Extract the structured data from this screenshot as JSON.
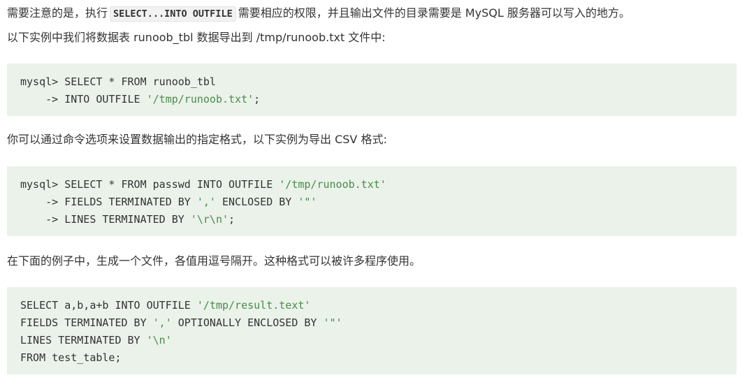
{
  "paragraphs": {
    "p1": {
      "before": "需要注意的是，执行",
      "code": "SELECT...INTO OUTFILE",
      "after": "需要相应的权限，并且输出文件的目录需要是 MySQL 服务器可以写入的地方。"
    },
    "p2": "以下实例中我们将数据表 runoob_tbl 数据导出到 /tmp/runoob.txt 文件中:",
    "p3": "你可以通过命令选项来设置数据输出的指定格式，以下实例为导出 CSV 格式:",
    "p4": "在下面的例子中，生成一个文件，各值用逗号隔开。这种格式可以被许多程序使用。"
  },
  "code_blocks": [
    {
      "lines": [
        {
          "a": "mysql> SELECT * FROM runoob_tbl",
          "s": "",
          "b": ""
        },
        {
          "a": "    -> INTO OUTFILE ",
          "s": "'/tmp/runoob.txt'",
          "b": ";"
        }
      ]
    },
    {
      "lines": [
        {
          "a": "mysql> SELECT * FROM passwd INTO OUTFILE ",
          "s": "'/tmp/runoob.txt'",
          "b": ""
        },
        {
          "a": "    -> FIELDS TERMINATED BY ",
          "s": "','",
          "b": " ENCLOSED BY ",
          "s2": "'\"'"
        },
        {
          "a": "    -> LINES TERMINATED BY ",
          "s": "'\\r\\n'",
          "b": ";"
        }
      ]
    },
    {
      "lines": [
        {
          "a": "SELECT a,b,a+b INTO OUTFILE ",
          "s": "'/tmp/result.text'",
          "b": ""
        },
        {
          "a": "FIELDS TERMINATED BY ",
          "s": "','",
          "b": " OPTIONALLY ENCLOSED BY ",
          "s2": "'\"'"
        },
        {
          "a": "LINES TERMINATED BY ",
          "s": "'\\n'",
          "b": ""
        },
        {
          "a": "FROM test_table;",
          "s": "",
          "b": ""
        }
      ]
    }
  ],
  "colors": {
    "code_bg": "#eaf2ea",
    "string": "#4a8c4a",
    "text": "#333333"
  }
}
